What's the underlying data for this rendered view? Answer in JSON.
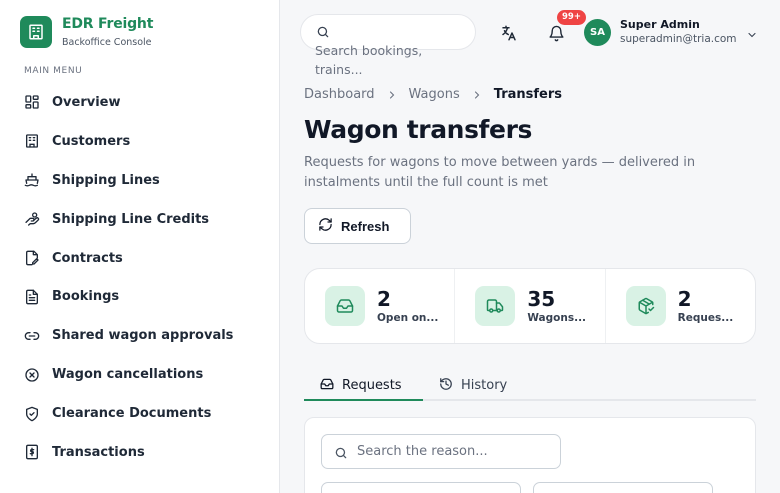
{
  "brand": {
    "title": "EDR Freight",
    "subtitle": "Backoffice Console",
    "icon": "building-icon"
  },
  "sidebar": {
    "caption": "MAIN MENU",
    "items": [
      {
        "label": "Overview",
        "icon": "grid-icon"
      },
      {
        "label": "Customers",
        "icon": "building-icon"
      },
      {
        "label": "Shipping Lines",
        "icon": "ship-icon"
      },
      {
        "label": "Shipping Line Credits",
        "icon": "hand-coins-icon"
      },
      {
        "label": "Contracts",
        "icon": "file-signature-icon"
      },
      {
        "label": "Bookings",
        "icon": "file-text-icon"
      },
      {
        "label": "Shared wagon approvals",
        "icon": "link-icon"
      },
      {
        "label": "Wagon cancellations",
        "icon": "x-circle-icon"
      },
      {
        "label": "Clearance Documents",
        "icon": "shield-check-icon"
      },
      {
        "label": "Transactions",
        "icon": "dollar-receipt-icon"
      }
    ]
  },
  "topbar": {
    "search_placeholder": "Search bookings, trains...",
    "notification_badge": "99+",
    "user": {
      "initials": "SA",
      "name": "Super Admin",
      "email": "superadmin@tria.com"
    }
  },
  "breadcrumb": [
    "Dashboard",
    "Wagons",
    "Transfers"
  ],
  "page": {
    "title": "Wagon transfers",
    "description": "Requests for wagons to move between yards — delivered in instalments until the full count is met",
    "refresh_label": "Refresh"
  },
  "stats": [
    {
      "value": "2",
      "label": "Open on...",
      "icon": "inbox-icon"
    },
    {
      "value": "35",
      "label": "Wagons...",
      "icon": "truck-icon"
    },
    {
      "value": "2",
      "label": "Reques...",
      "icon": "package-check-icon"
    }
  ],
  "tabs": [
    {
      "label": "Requests",
      "icon": "inbox-icon",
      "active": true
    },
    {
      "label": "History",
      "icon": "history-icon",
      "active": false
    }
  ],
  "filters": {
    "search_placeholder": "Search the reason..."
  },
  "colors": {
    "accent": "#1f8a5b",
    "accent_soft": "#d9f2e5",
    "badge": "#ef4444"
  }
}
